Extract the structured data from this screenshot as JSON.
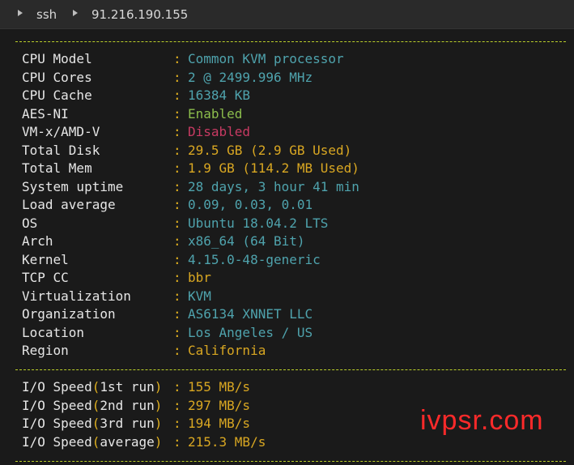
{
  "title_bar": {
    "segments": [
      "ssh",
      "91.216.190.155"
    ]
  },
  "system_info": [
    {
      "label": "CPU Model",
      "value": "Common KVM processor",
      "color": "cyan"
    },
    {
      "label": "CPU Cores",
      "value": "2 @ 2499.996 MHz",
      "color": "cyan"
    },
    {
      "label": "CPU Cache",
      "value": "16384 KB",
      "color": "cyan"
    },
    {
      "label": "AES-NI",
      "value": "Enabled",
      "color": "green"
    },
    {
      "label": "VM-x/AMD-V",
      "value": "Disabled",
      "color": "red"
    },
    {
      "label": "Total Disk",
      "value": "29.5 GB (2.9 GB Used)",
      "color": "yellow"
    },
    {
      "label": "Total Mem",
      "value": "1.9 GB (114.2 MB Used)",
      "color": "yellow"
    },
    {
      "label": "System uptime",
      "value": "28 days, 3 hour 41 min",
      "color": "cyan"
    },
    {
      "label": "Load average",
      "value": "0.09, 0.03, 0.01",
      "color": "cyan"
    },
    {
      "label": "OS",
      "value": "Ubuntu 18.04.2 LTS",
      "color": "cyan"
    },
    {
      "label": "Arch",
      "value": "x86_64 (64 Bit)",
      "color": "cyan"
    },
    {
      "label": "Kernel",
      "value": "4.15.0-48-generic",
      "color": "cyan"
    },
    {
      "label": "TCP CC",
      "value": "bbr",
      "color": "yellow"
    },
    {
      "label": "Virtualization",
      "value": "KVM",
      "color": "cyan"
    },
    {
      "label": "Organization",
      "value": "AS6134 XNNET LLC",
      "color": "cyan"
    },
    {
      "label": "Location",
      "value": "Los Angeles / US",
      "color": "cyan"
    },
    {
      "label": "Region",
      "value": "California",
      "color": "yellow"
    }
  ],
  "io_speed": [
    {
      "prefix": "I/O Speed",
      "run": "1st run",
      "value": "155 MB/s"
    },
    {
      "prefix": "I/O Speed",
      "run": "2nd run",
      "value": "297 MB/s"
    },
    {
      "prefix": "I/O Speed",
      "run": "3rd run",
      "value": "194 MB/s"
    },
    {
      "prefix": "I/O Speed",
      "run": "average",
      "value": "215.3 MB/s"
    }
  ],
  "separator": ":",
  "watermark": "ivpsr.com",
  "colors": {
    "cyan": "#4fa3ad",
    "green": "#8cbd4c",
    "red": "#c73a62",
    "yellow": "#d9a722",
    "dash": "#bcd02a"
  }
}
